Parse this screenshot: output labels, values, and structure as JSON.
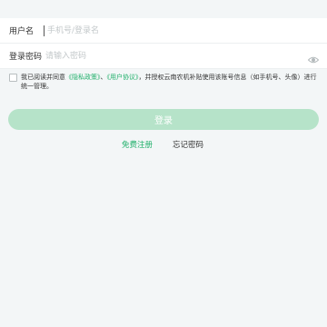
{
  "form": {
    "username": {
      "label": "用户名",
      "value": "",
      "placeholder": "手机号/登录名"
    },
    "password": {
      "label": "登录密码",
      "value": "",
      "placeholder": "请输入密码"
    }
  },
  "agreement": {
    "prefix": "我已阅读并同意",
    "privacy_link": "《隐私政策》",
    "separator": "、",
    "user_link": "《用户协议》",
    "suffix": "，并授权云南农机补贴使用该账号信息（如手机号、头像）进行统一管理。",
    "checked": false
  },
  "login_button": {
    "label": "登录"
  },
  "links": {
    "register": "免费注册",
    "forgot": "忘记密码"
  },
  "colors": {
    "accent": "#21b06b",
    "button": "#b6e3c9",
    "background": "#f3f6f7"
  }
}
